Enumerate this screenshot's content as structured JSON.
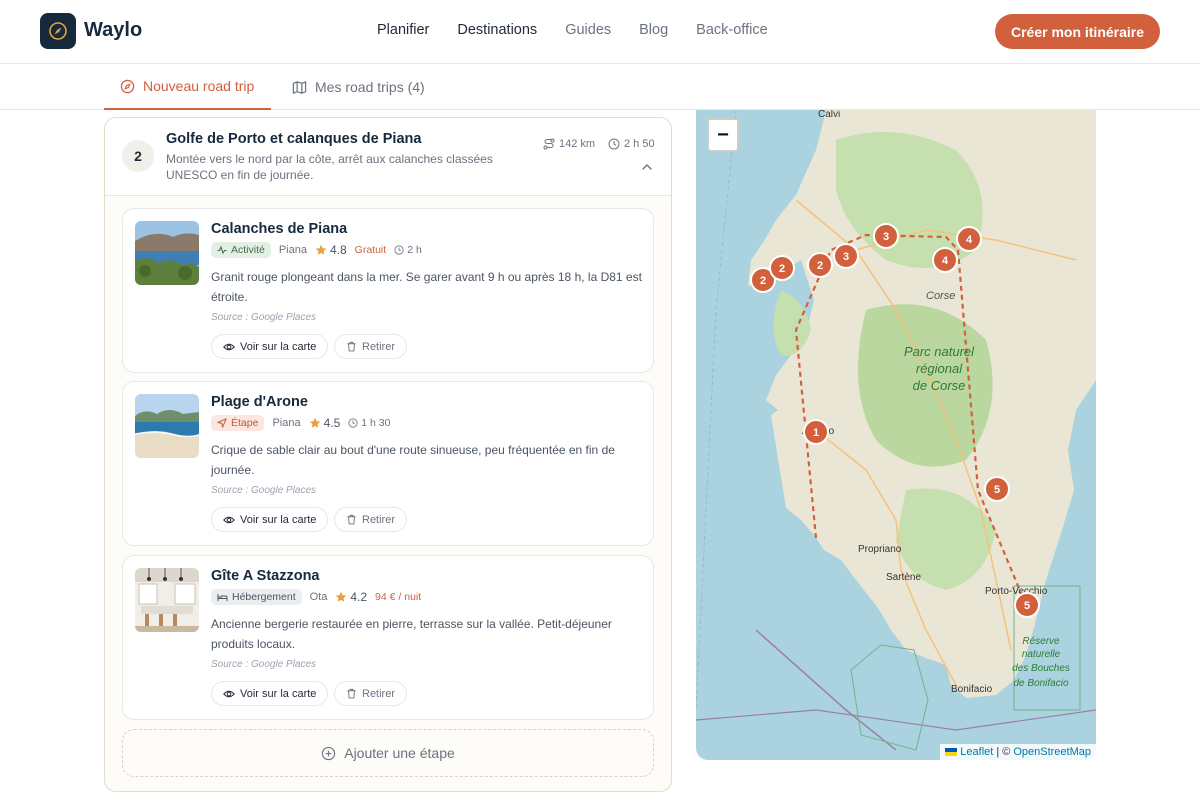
{
  "header": {
    "brand": "Waylo",
    "nav": [
      "Planifier",
      "Destinations",
      "Guides",
      "Blog",
      "Back-office"
    ],
    "cta": "Créer mon itinéraire"
  },
  "tabs": {
    "new": "Nouveau road trip",
    "mine": "Mes road trips (4)"
  },
  "day": {
    "number": "2",
    "title": "Golfe de Porto et calanques de Piana",
    "description": "Montée vers le nord par la côte, arrêt aux calanches classées UNESCO en fin de journée.",
    "distance": "142 km",
    "duration": "2 h 50"
  },
  "stops": [
    {
      "title": "Calanches de Piana",
      "badge": "Activité",
      "place": "Piana",
      "rating": "4.8",
      "price": "Gratuit",
      "duration": "2 h",
      "description": "Granit rouge plongeant dans la mer. Se garer avant 9 h ou après 18 h, la D81 est étroite.",
      "source": "Source : Google Places",
      "view_label": "Voir sur la carte",
      "remove_label": "Retirer"
    },
    {
      "title": "Plage d'Arone",
      "badge": "Étape",
      "place": "Piana",
      "rating": "4.5",
      "duration": "1 h 30",
      "description": "Crique de sable clair au bout d'une route sinueuse, peu fréquentée en fin de journée.",
      "source": "Source : Google Places",
      "view_label": "Voir sur la carte",
      "remove_label": "Retirer"
    },
    {
      "title": "Gîte A Stazzona",
      "badge": "Hébergement",
      "place": "Ota",
      "rating": "4.2",
      "price": "94 € / nuit",
      "description": "Ancienne bergerie restaurée en pierre, terrasse sur la vallée. Petit-déjeuner produits locaux.",
      "source": "Source : Google Places",
      "view_label": "Voir sur la carte",
      "remove_label": "Retirer"
    }
  ],
  "add_stop": "Ajouter une étape",
  "map": {
    "zoom_out": "−",
    "labels": {
      "calvi": "Calvi",
      "corse": "Corse",
      "parc1": "Parc naturel",
      "parc2": "régional",
      "parc3": "de Corse",
      "ajaccio": "Ajaccio",
      "propriano": "Propriano",
      "sartene": "Sartène",
      "porto_vecchio": "Porto-Vecchio",
      "reserve1": "Réserve",
      "reserve2": "naturelle",
      "reserve3": "des Bouches",
      "reserve4": "de Bonifacio",
      "bonifacio": "Bonifacio"
    },
    "markers": [
      "2",
      "2",
      "2",
      "3",
      "3",
      "4",
      "4",
      "1",
      "5",
      "5"
    ],
    "attribution": {
      "leaflet": "Leaflet",
      "separator": "| ©",
      "osm": "OpenStreetMap"
    }
  }
}
